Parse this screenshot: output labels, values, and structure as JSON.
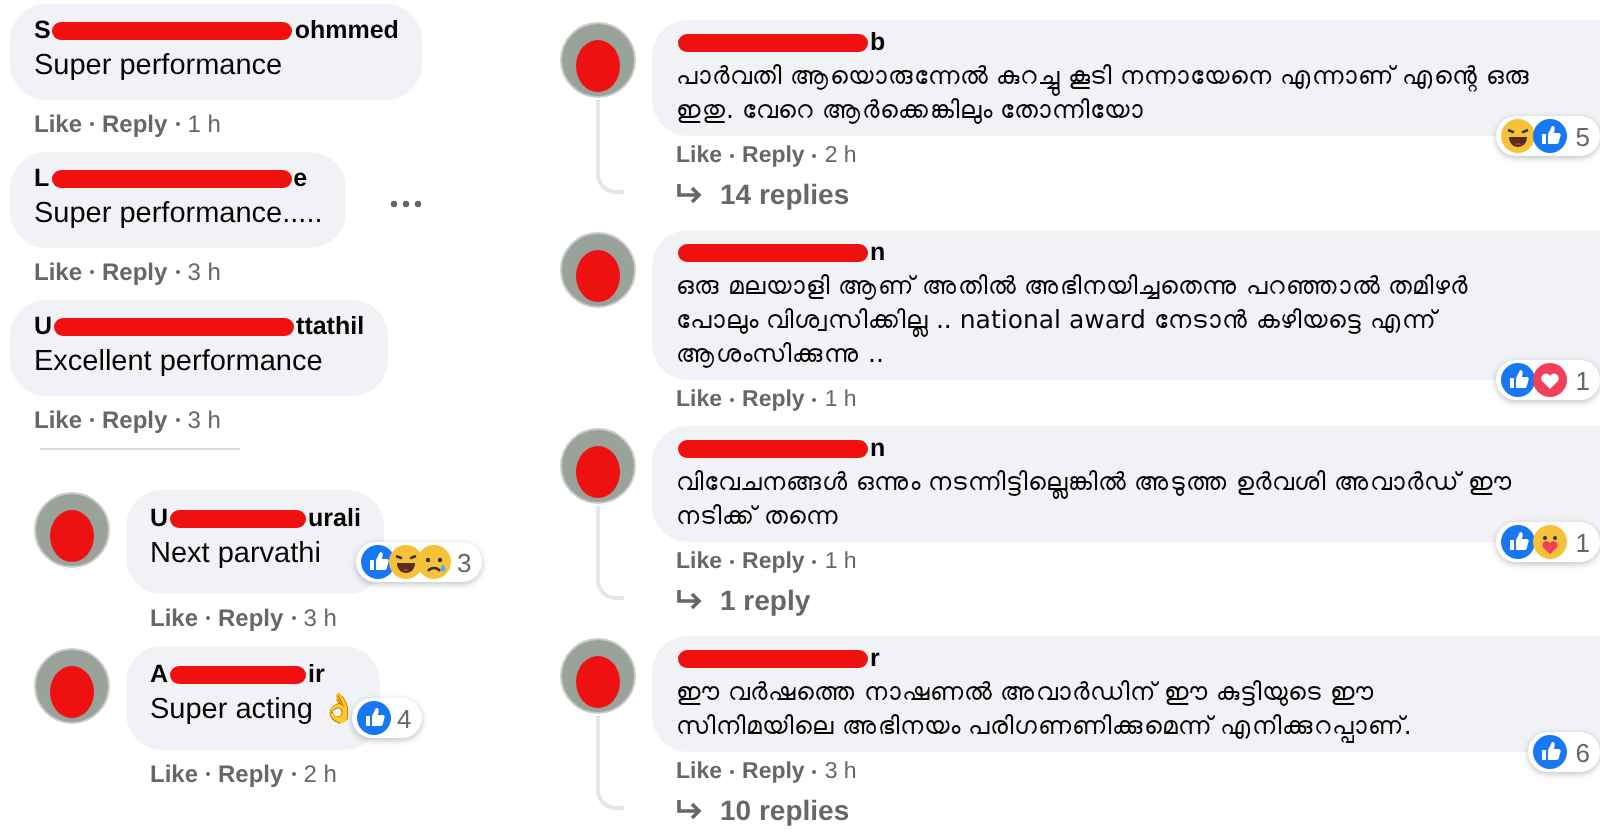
{
  "left_column": {
    "comments": [
      {
        "avatar": false,
        "name_lead": "S",
        "name_tail": "ohmmed",
        "text": "Super performance",
        "more_menu": false,
        "actions": [
          "Like",
          "Reply"
        ],
        "time": "1 h"
      },
      {
        "avatar": false,
        "name_lead": "L",
        "name_tail": "e",
        "text": "Super performance.....",
        "more_menu": true,
        "actions": [
          "Like",
          "Reply"
        ],
        "time": "3 h"
      },
      {
        "avatar": false,
        "name_lead": "U",
        "name_tail": "ttathil",
        "text": "Excellent performance",
        "more_menu": false,
        "actions": [
          "Like",
          "Reply"
        ],
        "time": "3 h"
      },
      {
        "avatar": true,
        "name_lead": "U",
        "name_tail": "urali",
        "text": "Next parvathi",
        "more_menu": false,
        "reactions": [
          {
            "kind": "like"
          },
          {
            "kind": "haha"
          },
          {
            "kind": "sad"
          }
        ],
        "reaction_count": "3",
        "actions": [
          "Like",
          "Reply"
        ],
        "time": "3 h"
      },
      {
        "avatar": true,
        "name_lead": "A",
        "name_tail": "ir",
        "text": "Super acting 👌",
        "more_menu": false,
        "reactions": [
          {
            "kind": "like"
          }
        ],
        "reaction_count": "4",
        "actions": [
          "Like",
          "Reply"
        ],
        "time": "2 h"
      }
    ]
  },
  "right_column": {
    "comments": [
      {
        "avatar": true,
        "name_tail": "b",
        "text": "പാർവതി ആയൊരുന്നേൽ കുറച്ചു കൂടി നന്നായേനെ എന്നാണ് എന്റെ ഒരു ഇതു. വേറെ ആർക്കെങ്കിലും തോന്നിയോ",
        "reactions": [
          {
            "kind": "haha"
          },
          {
            "kind": "like"
          }
        ],
        "reaction_count": "5",
        "actions": [
          "Like",
          "Reply"
        ],
        "time": "2 h",
        "replies": "14 replies"
      },
      {
        "avatar": true,
        "name_tail": "n",
        "text": "ഒരു മലയാളി ആണ് അതിൽ അഭിനയിച്ചതെന്നു പറഞ്ഞാൽ തമിഴർ പോലും വിശ്വസിക്കില്ല .. national award നേടാൻ കഴിയട്ടെ എന്ന് ആശംസിക്കുന്നു ..",
        "reactions": [
          {
            "kind": "like"
          },
          {
            "kind": "love"
          }
        ],
        "reaction_count": "1",
        "actions": [
          "Like",
          "Reply"
        ],
        "time": "1 h"
      },
      {
        "avatar": true,
        "name_tail": "n",
        "text": "വിവേചനങ്ങൾ ഒന്നും നടന്നിട്ടില്ലെങ്കിൽ അടുത്ത ഉർവശി അവാർഡ് ഈ നടിക്ക് തന്നെ",
        "reactions": [
          {
            "kind": "like"
          },
          {
            "kind": "care"
          }
        ],
        "reaction_count": "1",
        "actions": [
          "Like",
          "Reply"
        ],
        "time": "1 h",
        "replies": "1 reply"
      },
      {
        "avatar": true,
        "name_tail": "r",
        "text": "ഈ വർഷത്തെ നാഷണൽ അവാർഡിന് ഈ കുട്ടിയുടെ ഈ സിനിമയിലെ അഭിനയം പരിഗണണിക്കുമെന്ന് എനിക്കുറപ്പാണ്.",
        "reactions": [
          {
            "kind": "like"
          }
        ],
        "reaction_count": "6",
        "actions": [
          "Like",
          "Reply"
        ],
        "time": "3 h",
        "replies": "10 replies"
      }
    ]
  }
}
